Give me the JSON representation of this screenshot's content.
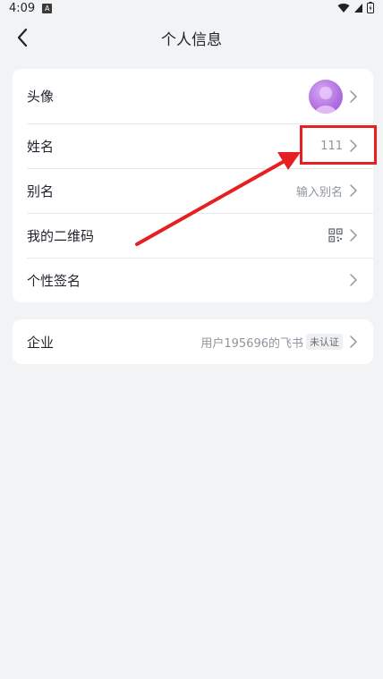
{
  "status_bar": {
    "time": "4:09",
    "a_badge": "A"
  },
  "header": {
    "title": "个人信息"
  },
  "profile_items": [
    {
      "label": "头像"
    },
    {
      "label": "姓名",
      "value": "111"
    },
    {
      "label": "别名",
      "value": "输入别名"
    },
    {
      "label": "我的二维码"
    },
    {
      "label": "个性签名"
    }
  ],
  "company": {
    "label": "企业",
    "value": "用户195696的飞书",
    "badge": "未认证"
  },
  "annotation": {
    "color": "#e62020"
  }
}
